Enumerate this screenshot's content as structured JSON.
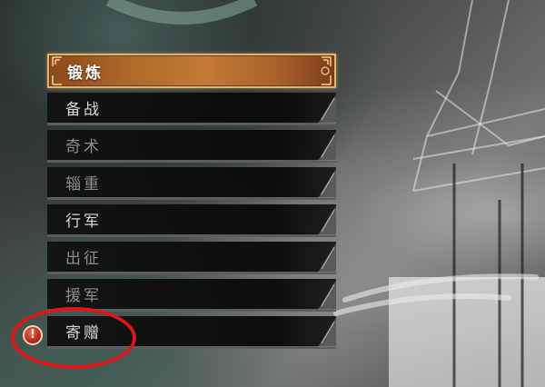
{
  "menu": {
    "items": [
      {
        "label": "锻炼",
        "state": "selected"
      },
      {
        "label": "备战",
        "state": "normal"
      },
      {
        "label": "奇术",
        "state": "dim"
      },
      {
        "label": "辎重",
        "state": "dim"
      },
      {
        "label": "行军",
        "state": "normal"
      },
      {
        "label": "出征",
        "state": "dim"
      },
      {
        "label": "援军",
        "state": "dim"
      },
      {
        "label": "寄赠",
        "state": "normal"
      }
    ]
  },
  "alert": {
    "icon": "exclamation-alert-icon",
    "symbol": "!"
  },
  "annotation": {
    "color": "#e01515"
  },
  "colors": {
    "selected_fill": "#b06b2a",
    "selected_border": "#e3b36a",
    "item_fill": "#0f0f0f",
    "label_normal": "#d8d8d8",
    "label_dim": "#8d8d8d"
  }
}
